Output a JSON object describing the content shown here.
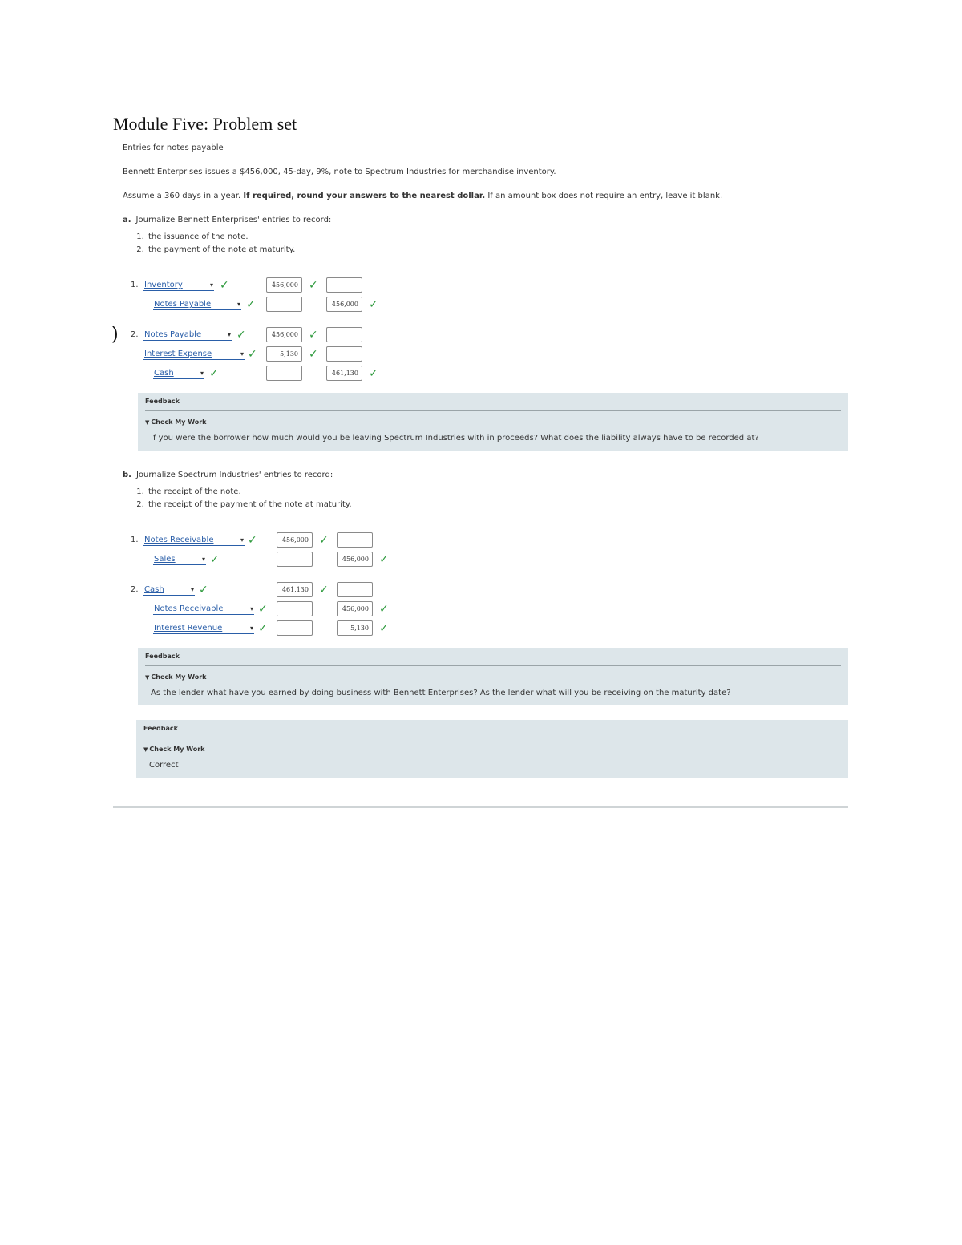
{
  "title": "Module Five: Problem set",
  "heading": "Entries for notes payable",
  "problem": "Bennett Enterprises issues a $456,000, 45-day, 9%, note to Spectrum Industries for merchandise inventory.",
  "instructions": {
    "prefix": "Assume a 360 days in a year.",
    "bold": "If required, round your answers to the nearest dollar.",
    "suffix": "If an amount box does not require an entry, leave it blank."
  },
  "part_a": {
    "letter": "a.",
    "label": "Journalize Bennett Enterprises' entries to record:",
    "items": [
      "the issuance of the note.",
      "the payment of the note at maturity."
    ],
    "entry1": {
      "num": "1.",
      "rows": [
        {
          "account": "Inventory",
          "debit": "456,000",
          "credit": ""
        },
        {
          "account": "Notes Payable",
          "debit": "",
          "credit": "456,000"
        }
      ]
    },
    "entry2": {
      "num": "2.",
      "rows": [
        {
          "account": "Notes Payable",
          "debit": "456,000",
          "credit": ""
        },
        {
          "account": "Interest Expense",
          "debit": "5,130",
          "credit": ""
        },
        {
          "account": "Cash",
          "debit": "",
          "credit": "461,130"
        }
      ]
    },
    "feedback": {
      "title": "Feedback",
      "check": "Check My Work",
      "text": "If you were the borrower how much would you be leaving Spectrum Industries with in proceeds? What does the liability always have to be recorded at?"
    }
  },
  "part_b": {
    "letter": "b.",
    "label": "Journalize Spectrum Industries' entries to record:",
    "items": [
      "the receipt of the note.",
      "the receipt of the payment of the note at maturity."
    ],
    "entry1": {
      "num": "1.",
      "rows": [
        {
          "account": "Notes Receivable",
          "debit": "456,000",
          "credit": ""
        },
        {
          "account": "Sales",
          "debit": "",
          "credit": "456,000"
        }
      ]
    },
    "entry2": {
      "num": "2.",
      "rows": [
        {
          "account": "Cash",
          "debit": "461,130",
          "credit": ""
        },
        {
          "account": "Notes Receivable",
          "debit": "",
          "credit": "456,000"
        },
        {
          "account": "Interest Revenue",
          "debit": "",
          "credit": "5,130"
        }
      ]
    },
    "feedback": {
      "title": "Feedback",
      "check": "Check My Work",
      "text": "As the lender what have you earned by doing business with Bennett Enterprises? As the lender what will you be receiving on the maturity date?"
    }
  },
  "final_feedback": {
    "title": "Feedback",
    "check": "Check My Work",
    "text": "Correct"
  },
  "side_mark": ")",
  "icons": {
    "check": "check-icon",
    "caret": "dropdown-caret-icon"
  },
  "colors": {
    "link": "#2a5ea8",
    "check": "#2e9a3d",
    "feedback_bg": "#dde6ea"
  }
}
